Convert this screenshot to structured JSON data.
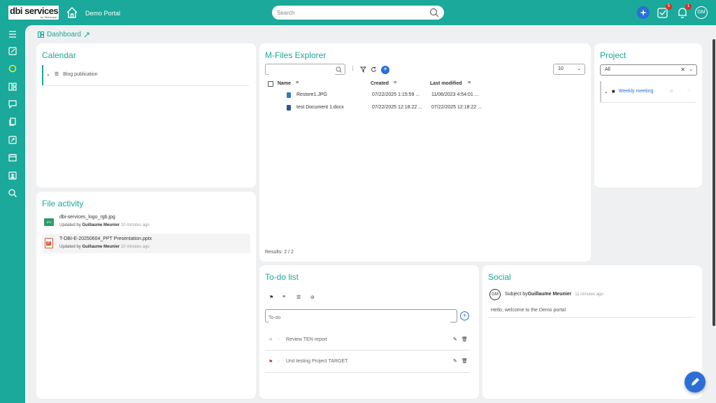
{
  "brand": {
    "logo_main": "dbi services",
    "logo_sub": "by Telescope",
    "portal": "Demo Portal",
    "accent": "#1aa99a"
  },
  "search": {
    "placeholder": "Search"
  },
  "notifications": {
    "tasks_count": "5",
    "bell_count": "1",
    "avatar": "GM"
  },
  "page_title": "Dashboard",
  "calendar": {
    "title": "Calendar",
    "item": "Blog publication"
  },
  "file_activity": {
    "title": "File activity",
    "items": [
      {
        "name": "dbi-services_logo_rgb.jpg",
        "updated_by_prefix": "Updated by",
        "user": "Guillaume Meunier",
        "time": "10 minutes ago",
        "icon": "jpg-icon"
      },
      {
        "name": "T-DBI-E-20250604_PPT Presentation.pptx",
        "updated_by_prefix": "Updated by",
        "user": "Guillaume Meunier",
        "time": "10 minutes ago",
        "icon": "pptx-icon"
      }
    ]
  },
  "mfiles": {
    "title": "M-Files Explorer",
    "page_size": "10",
    "columns": {
      "name": "Name",
      "created": "Created",
      "modified": "Last modified"
    },
    "rows": [
      {
        "name": "Restore1.JPG",
        "created": "07/22/2025 1:15:59 ...",
        "modified": "11/06/2023 4:54:01 ..."
      },
      {
        "name": "test Document 1.docx",
        "created": "07/22/2025 12:18:22 ...",
        "modified": "07/22/2025 12:18:22 ..."
      }
    ],
    "results": "Results: 2 / 2"
  },
  "project": {
    "title": "Project",
    "filter": "All",
    "item": "Weekly meeting"
  },
  "todo": {
    "title": "To-do list",
    "placeholder": "To-do",
    "items": [
      {
        "label": "Review TEN report",
        "flag_color": "#cccccc"
      },
      {
        "label": "Unit testing Project TARGET",
        "flag_color": "#d93025"
      }
    ]
  },
  "social": {
    "title": "Social",
    "avatar": "GM",
    "subject_prefix": "Subject by",
    "user": "Guillaume Meunier",
    "time": "11 minutes ago",
    "message": "Hello, welcome to the Demo portal"
  }
}
